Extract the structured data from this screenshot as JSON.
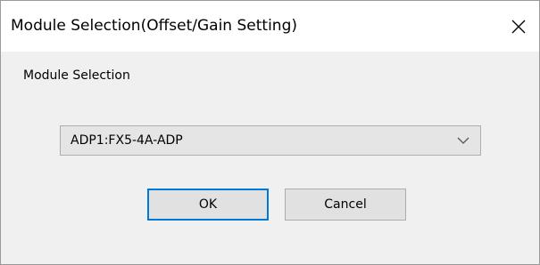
{
  "window": {
    "title": "Module Selection(Offset/Gain Setting)",
    "close_icon": "close-icon"
  },
  "section": {
    "label": "Module Selection"
  },
  "module_select": {
    "selected_value": "ADP1:FX5-4A-ADP",
    "dropdown_icon": "chevron-down-icon"
  },
  "buttons": {
    "ok_label": "OK",
    "cancel_label": "Cancel"
  },
  "colors": {
    "focus_accent": "#0078d7",
    "dialog_background": "#f0f0f0",
    "titlebar_background": "#ffffff"
  }
}
